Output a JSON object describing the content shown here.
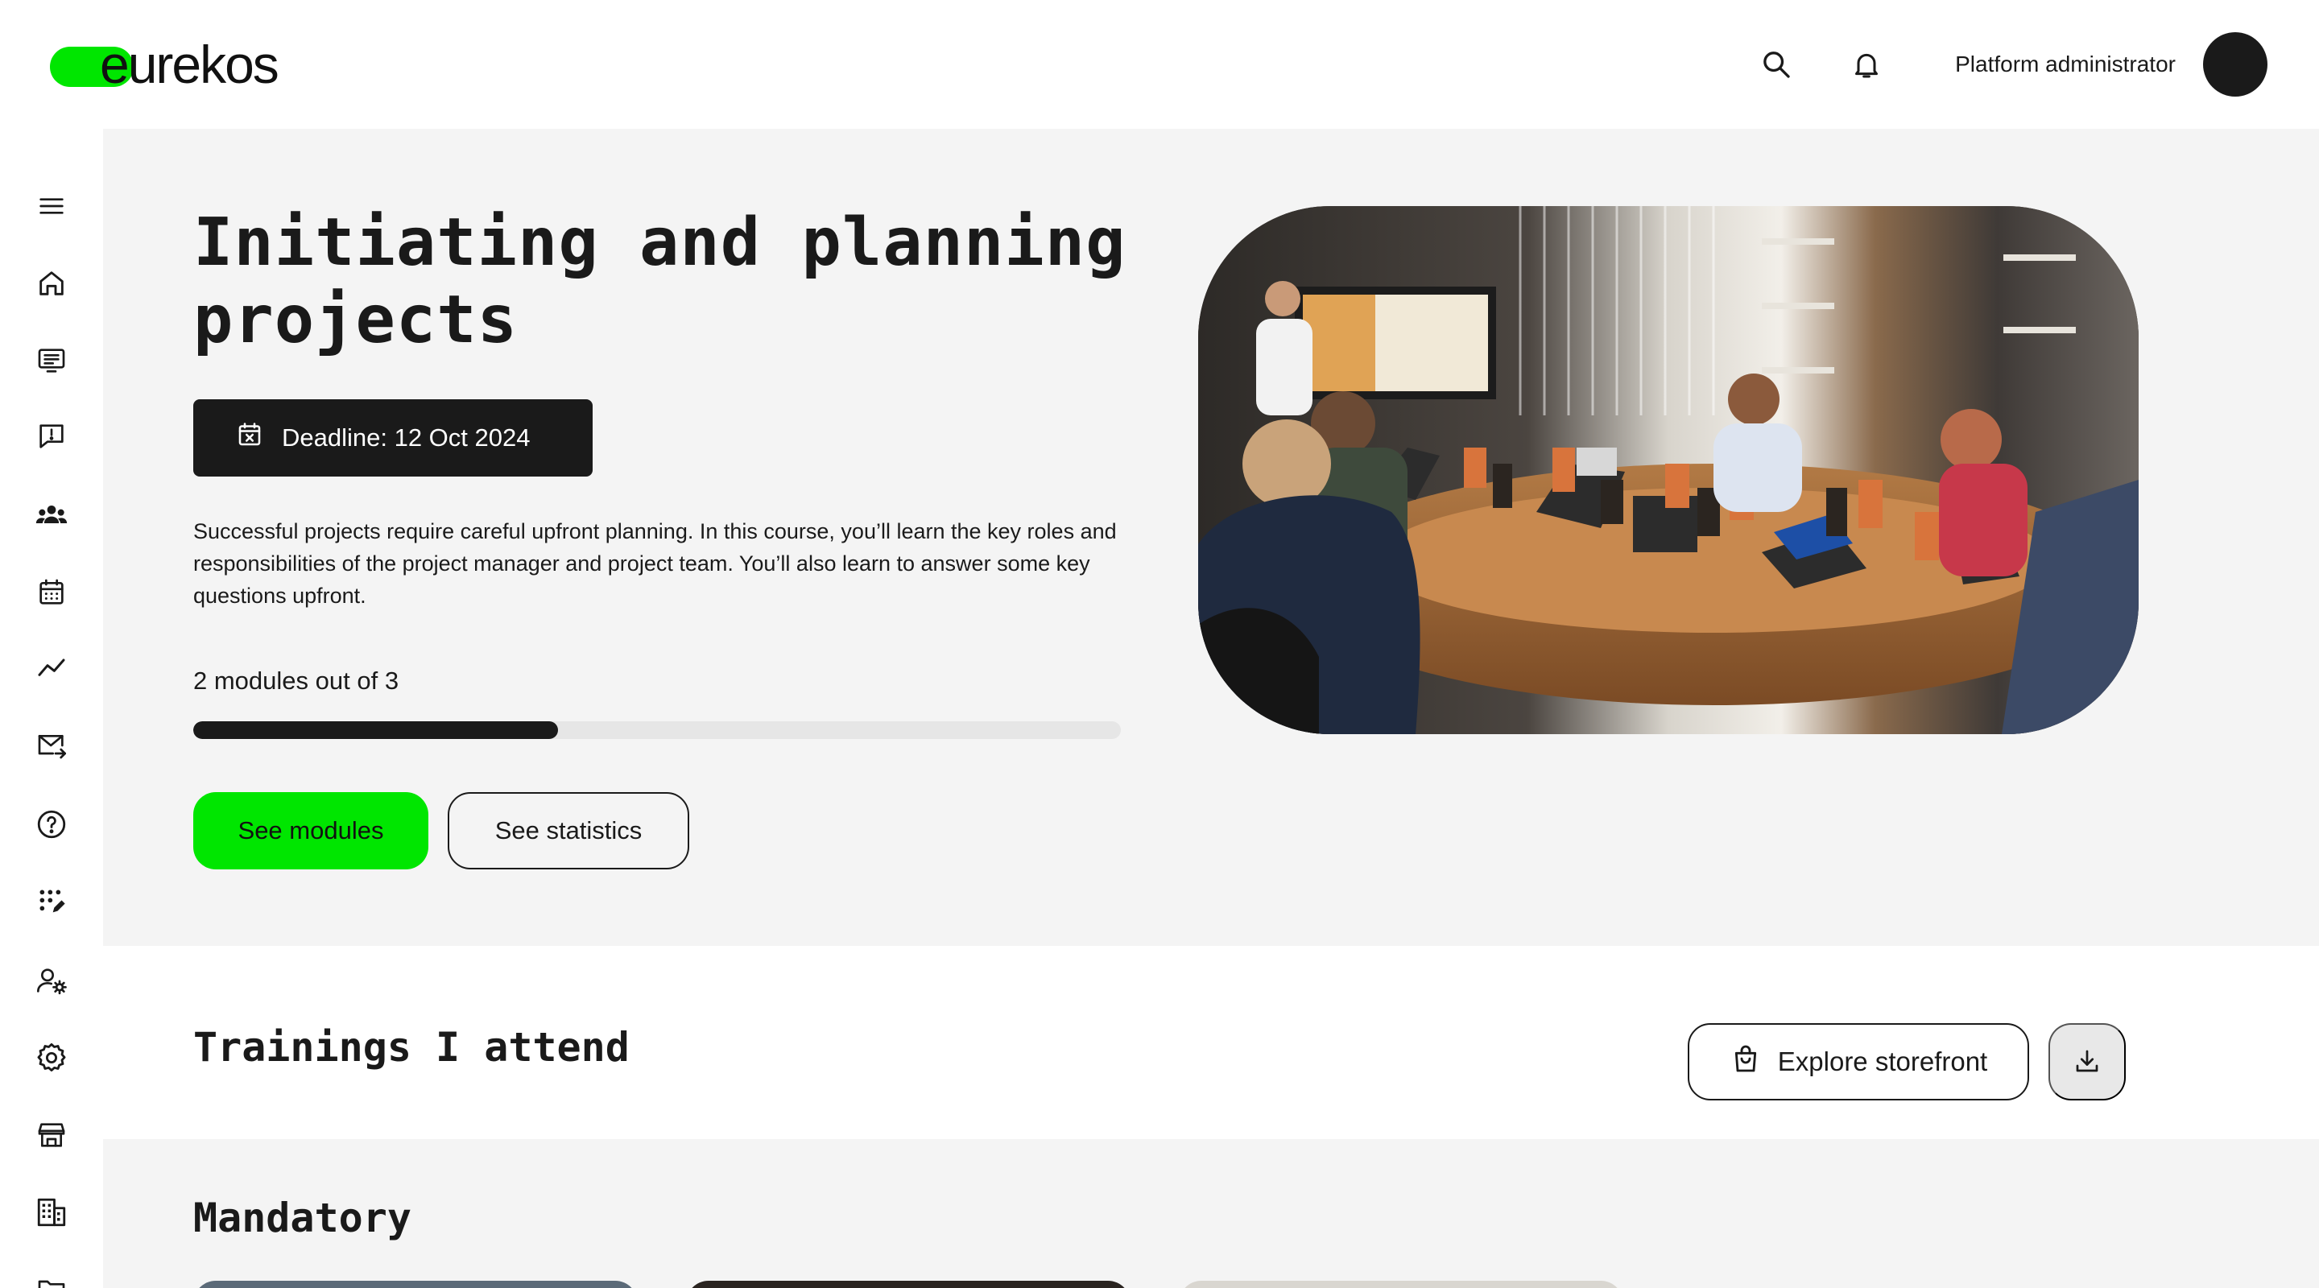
{
  "brand": {
    "logo_text": "eurekos",
    "accent_color": "#00e600"
  },
  "header": {
    "search_icon": "search-icon",
    "notifications_icon": "bell-icon",
    "user_name": "Platform administrator"
  },
  "sidebar": {
    "items": [
      {
        "icon": "menu-icon"
      },
      {
        "icon": "home-icon"
      },
      {
        "icon": "course-list-icon"
      },
      {
        "icon": "feedback-icon"
      },
      {
        "icon": "groups-icon"
      },
      {
        "icon": "calendar-icon"
      },
      {
        "icon": "analytics-icon"
      },
      {
        "icon": "mail-forward-icon"
      },
      {
        "icon": "help-icon"
      },
      {
        "icon": "apps-edit-icon"
      },
      {
        "icon": "user-settings-icon"
      },
      {
        "icon": "gear-icon"
      },
      {
        "icon": "storefront-icon"
      },
      {
        "icon": "organization-icon"
      },
      {
        "icon": "folder-icon"
      }
    ]
  },
  "hero": {
    "title": "Initiating and planning projects",
    "deadline": "Deadline: 12 Oct 2024",
    "description": "Successful projects require careful upfront planning. In this course, you’ll learn the key roles and responsibilities of the project manager and project team. You’ll also learn to answer some key questions upfront.",
    "progress_label": "2 modules out of 3",
    "progress_completed": 2,
    "progress_total": 3,
    "primary_button": "See modules",
    "secondary_button": "See statistics"
  },
  "trainings": {
    "title": "Trainings I attend",
    "storefront_button": "Explore storefront"
  },
  "mandatory": {
    "title": "Mandatory"
  }
}
